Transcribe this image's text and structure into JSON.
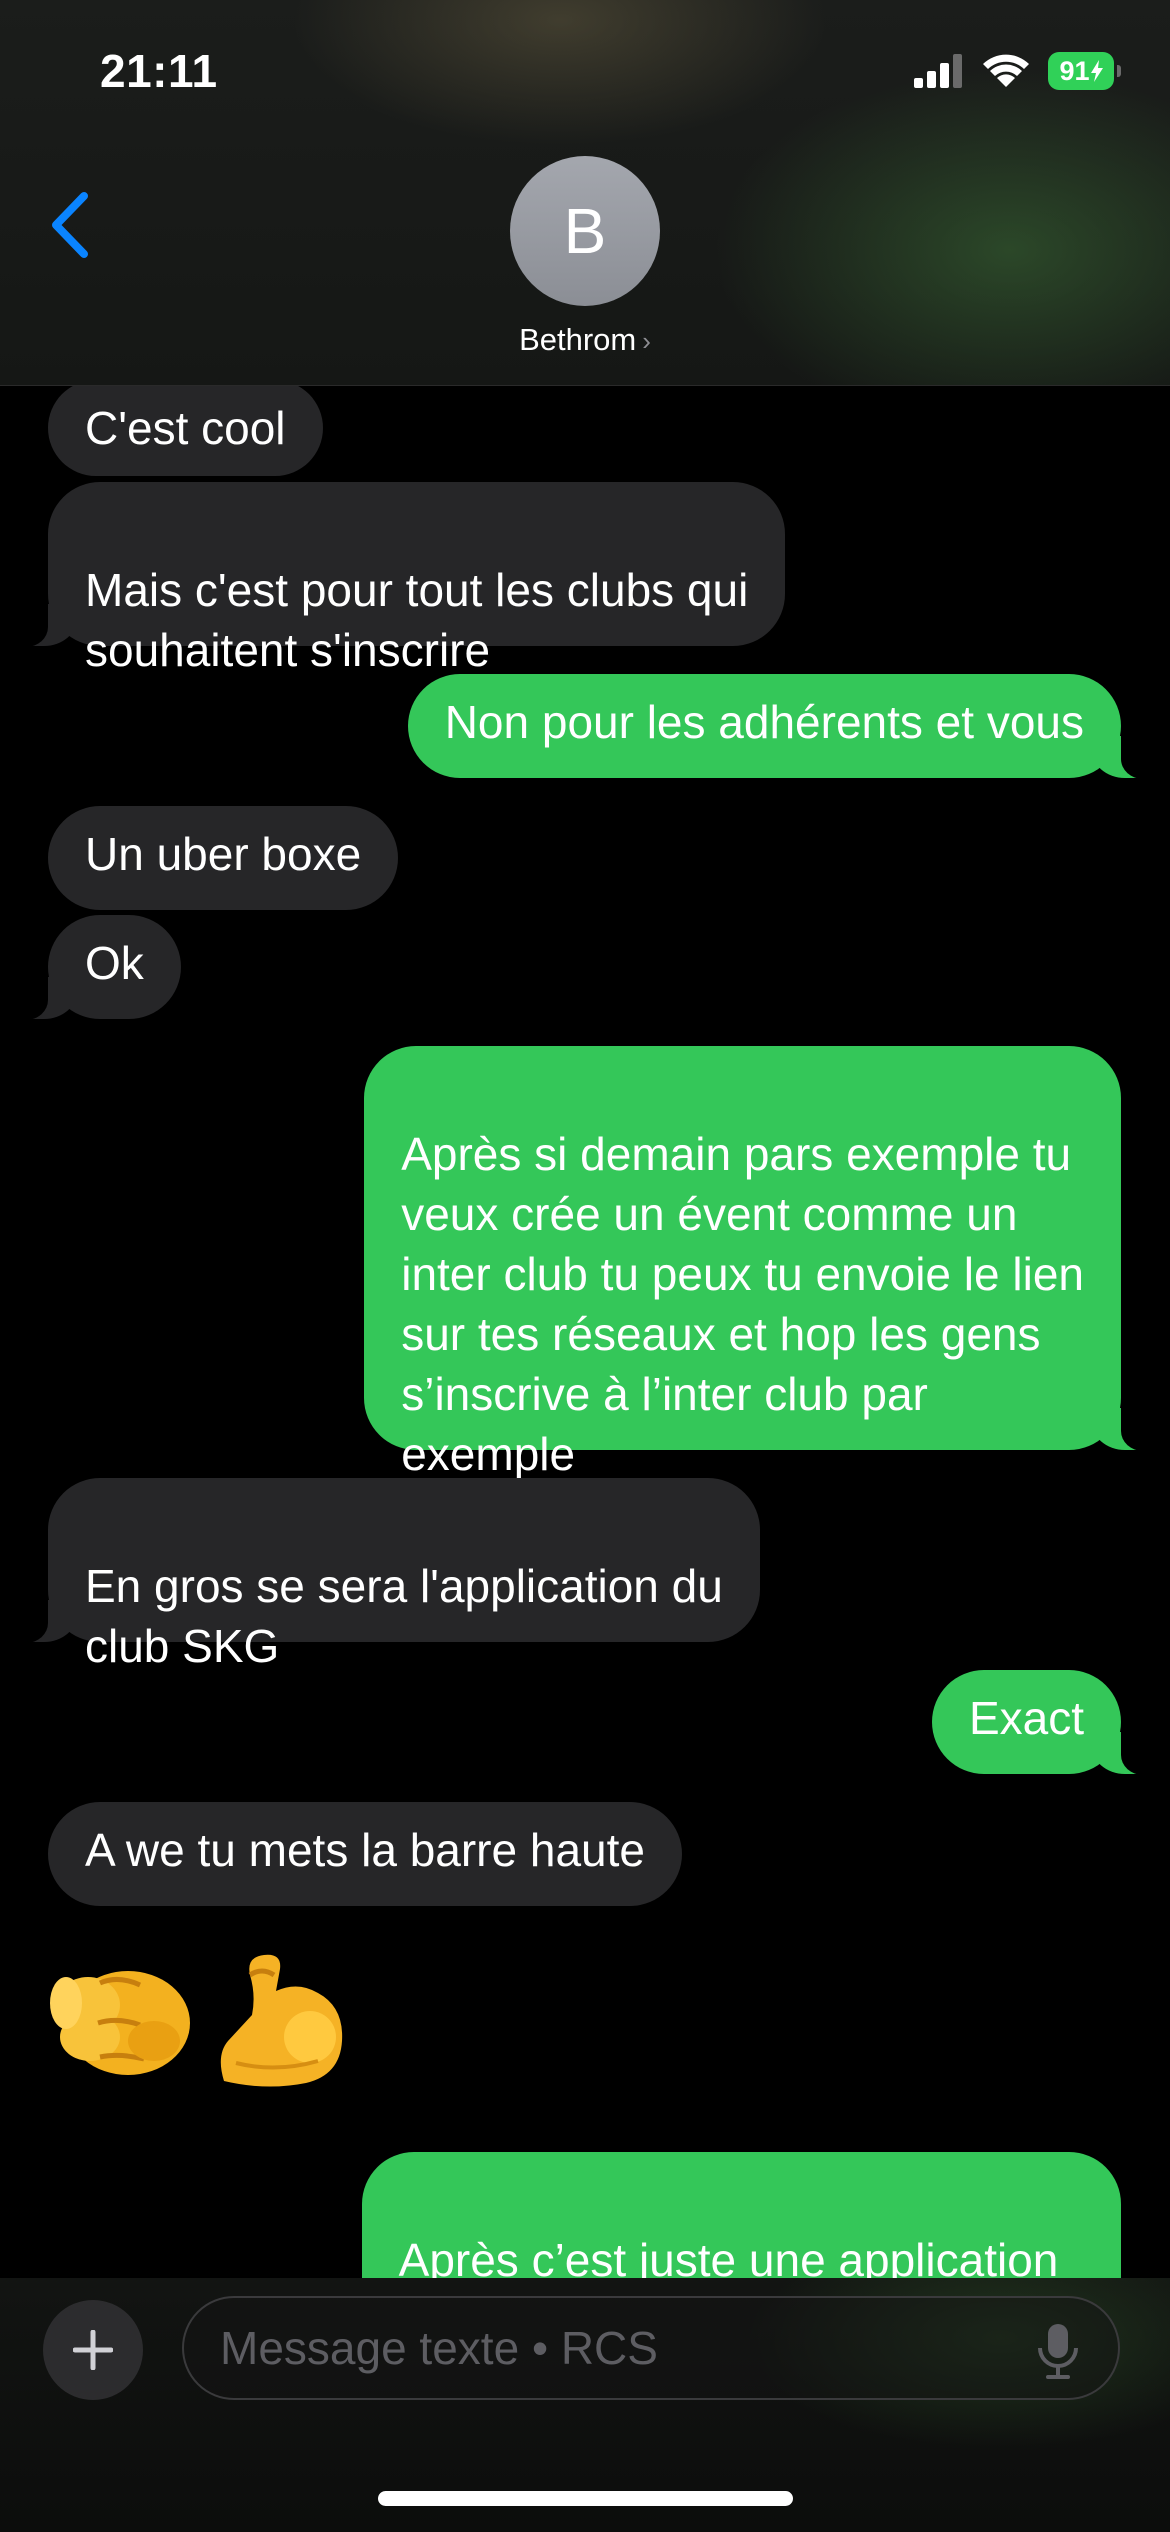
{
  "status": {
    "time": "21:11",
    "battery": "91"
  },
  "contact": {
    "initial": "B",
    "name": "Bethrom",
    "chevron": "›"
  },
  "messages": [
    {
      "dir": "in",
      "text": "C'est cool"
    },
    {
      "dir": "in",
      "text": "Mais c'est pour tout les clubs qui\nsouhaitent s'inscrire"
    },
    {
      "dir": "out",
      "text": "Non pour les adhérents et vous"
    },
    {
      "dir": "in",
      "text": "Un uber boxe"
    },
    {
      "dir": "in",
      "text": "Ok"
    },
    {
      "dir": "out",
      "text": "Après si demain pars exemple tu\nveux crée un évent comme un\ninter club tu peux tu envoie le lien\nsur tes réseaux et hop les gens\ns’inscrive à l’inter club par\nexemple"
    },
    {
      "dir": "in",
      "text": "En gros se sera l'application du\nclub SKG"
    },
    {
      "dir": "out",
      "text": "Exact"
    },
    {
      "dir": "in",
      "text": "A we tu mets la barre haute"
    },
    {
      "dir": "out",
      "text": "Après c’est juste une application\nde test ça n’est en aucun cas une"
    }
  ],
  "emoji_message": {
    "icons": [
      "pointing-fist-emoji",
      "flexed-biceps-emoji"
    ]
  },
  "composer": {
    "placeholder": "Message texte • RCS",
    "plus": "+"
  },
  "colors": {
    "outgoing": "#34c759",
    "incoming": "#262628",
    "accent": "#0a84ff"
  }
}
